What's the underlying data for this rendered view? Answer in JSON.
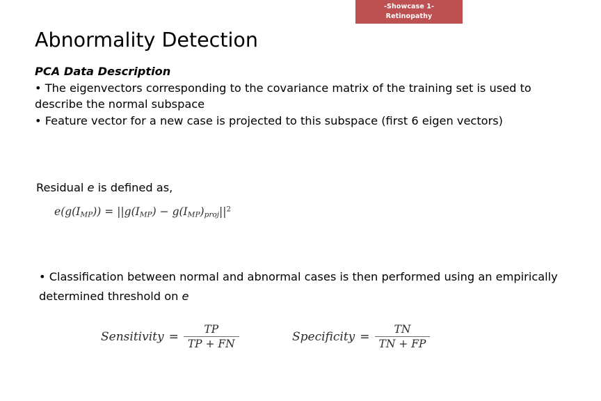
{
  "banner": {
    "line1": "-Showcase 1-",
    "line2": "Retinopathy",
    "background_color": "#bd5050",
    "text_color": "#ffffff"
  },
  "slide": {
    "title": "Abnormality Detection"
  },
  "content": {
    "subheading": "PCA Data Description",
    "bullet1": "• The eigenvectors corresponding to the covariance matrix of the training set is used to describe the normal subspace",
    "bullet2": "• Feature vector for a new case is projected to this subspace (first 6 eigen vectors)",
    "residual_intro_before": "Residual ",
    "residual_intro_symbol": "e",
    "residual_intro_after": " is defined as,",
    "bullet3_before": "• Classification between normal and abnormal cases is then performed using an empirically determined threshold on ",
    "bullet3_symbol": "e"
  },
  "equations": {
    "residual": {
      "lhs_fn": "e",
      "lhs_inner": "g(I",
      "lhs_sub": "MP",
      "lhs_close": "))",
      "equals": "=",
      "norm_open": "||",
      "term1": "g(I",
      "term1_sub": "MP",
      "term1_close": ")",
      "minus": "−",
      "term2": "g(I",
      "term2_sub": "MP",
      "term2_close": ")",
      "term2_sub2": "proj",
      "norm_close": "||",
      "exponent": "2",
      "plain": "e(g(I_MP)) = ||g(I_MP) − g(I_MP)_proj||²"
    },
    "sensitivity": {
      "name": "Sensitivity",
      "equals": "=",
      "numerator": "TP",
      "denominator": "TP + FN"
    },
    "specificity": {
      "name": "Specificity",
      "equals": "=",
      "numerator": "TN",
      "denominator": "TN + FP"
    }
  }
}
